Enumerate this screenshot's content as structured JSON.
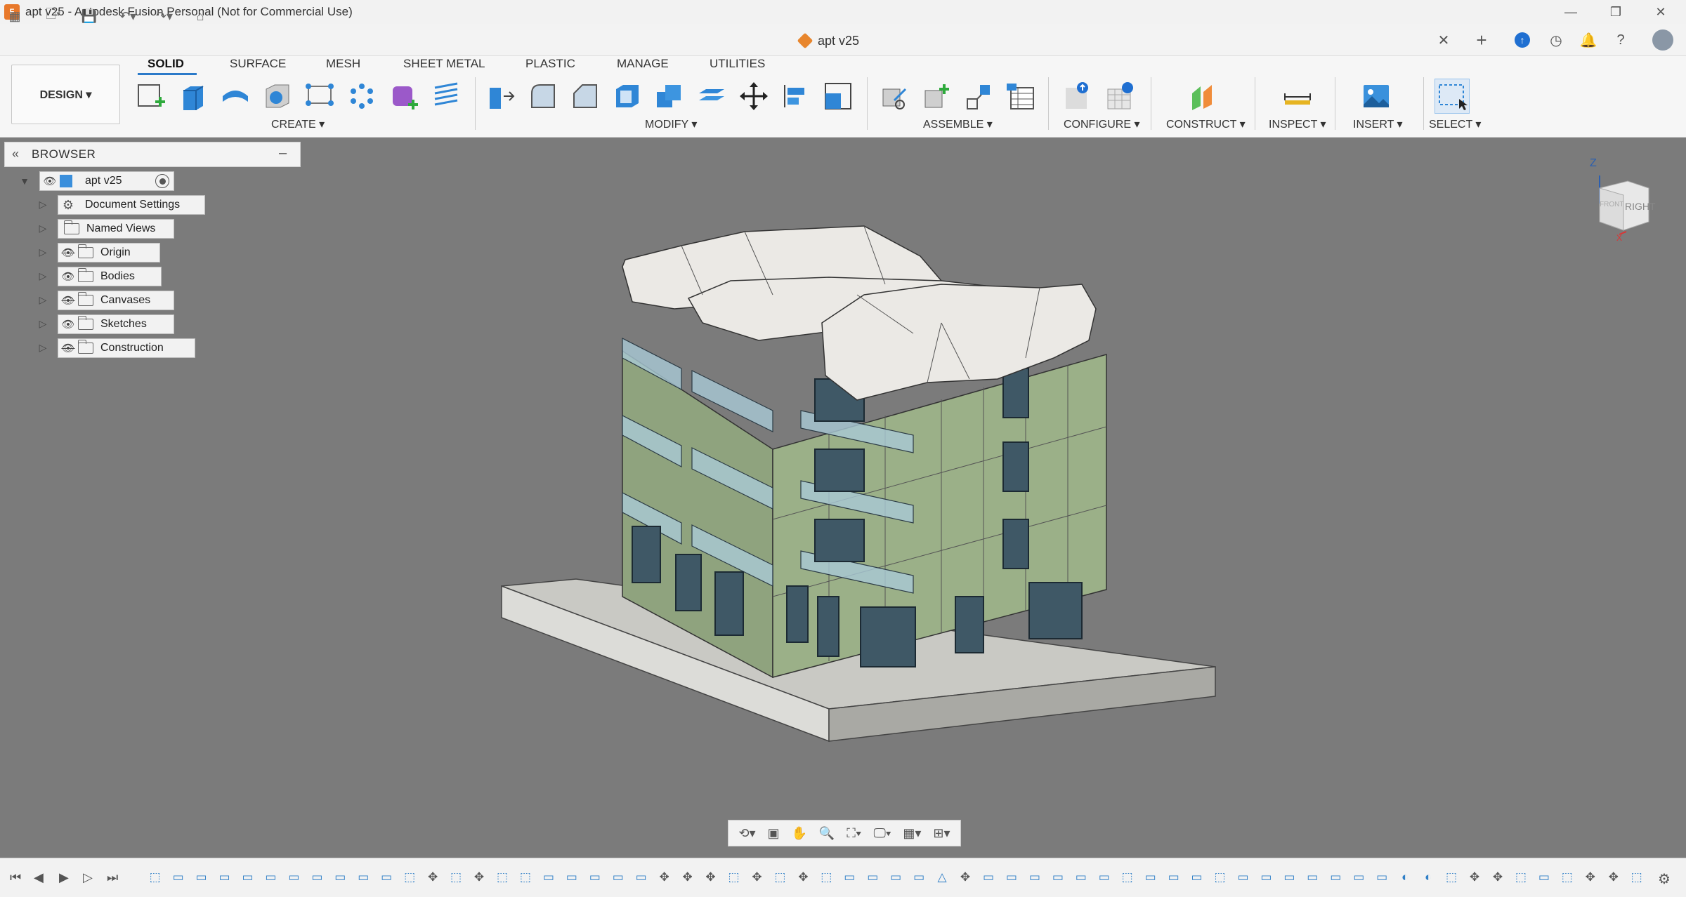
{
  "window": {
    "app_logo": "F",
    "title": "apt v25 - Autodesk Fusion Personal (Not for Commercial Use)",
    "minimize": "—",
    "maximize": "❐",
    "close": "✕"
  },
  "document_tab": {
    "label": "apt v25",
    "close": "✕"
  },
  "design_button": {
    "label": "DESIGN ▾"
  },
  "ribbon_tabs": [
    {
      "label": "SOLID",
      "active": true
    },
    {
      "label": "SURFACE"
    },
    {
      "label": "MESH"
    },
    {
      "label": "SHEET METAL"
    },
    {
      "label": "PLASTIC"
    },
    {
      "label": "MANAGE"
    },
    {
      "label": "UTILITIES"
    }
  ],
  "ribbon_groups": {
    "create": "CREATE ▾",
    "modify": "MODIFY ▾",
    "assemble": "ASSEMBLE ▾",
    "configure": "CONFIGURE ▾",
    "construct": "CONSTRUCT ▾",
    "inspect": "INSPECT ▾",
    "insert": "INSERT ▾",
    "select": "SELECT ▾"
  },
  "browser": {
    "title": "BROWSER",
    "collapse": "«",
    "minimize": "–",
    "root": {
      "label": "apt v25"
    },
    "nodes": [
      {
        "label": "Document Settings"
      },
      {
        "label": "Named Views"
      },
      {
        "label": "Origin"
      },
      {
        "label": "Bodies"
      },
      {
        "label": "Canvases"
      },
      {
        "label": "Sketches"
      },
      {
        "label": "Construction"
      }
    ]
  },
  "viewcube": {
    "right": "RIGHT",
    "front": "FRONT",
    "z": "Z",
    "x": "X"
  },
  "colors": {
    "viewport": "#7b7b7b",
    "accent": "#2b7ac9",
    "building_wall": "#93a882",
    "roof": "#e8e6e2",
    "glass": "#a9c9d6",
    "base": "#c9c9c4"
  }
}
